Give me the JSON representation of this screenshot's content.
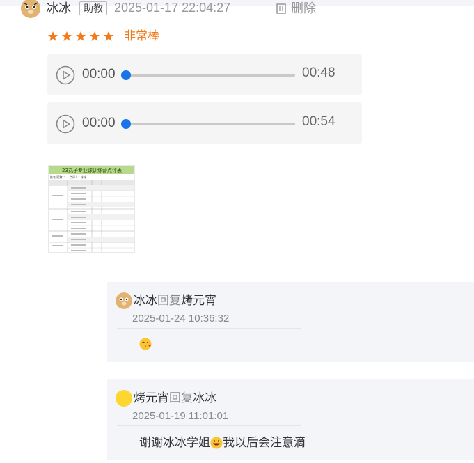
{
  "comment": {
    "author": "冰冰",
    "role_badge": "助教",
    "timestamp": "2025-01-17 22:04:27",
    "delete_label": "删除",
    "rating": {
      "stars": 5,
      "max": 5,
      "label": "非常棒"
    }
  },
  "audio_clips": [
    {
      "current": "00:00",
      "duration": "00:48",
      "progress": 0
    },
    {
      "current": "00:00",
      "duration": "00:54",
      "progress": 0
    }
  ],
  "attachment": {
    "title": "23丸子专业课训练营点评表",
    "subtitle_left": "姓名(昵称)：",
    "subtitle_right": "点评人：冰冰"
  },
  "replies": [
    {
      "from": "冰冰",
      "reply_word": "回复",
      "to": "烤元宵",
      "time": "2025-01-24 10:36:32",
      "body": "",
      "emoji": "kiss-face"
    },
    {
      "from": "烤元宵",
      "reply_word": "回复",
      "to": "冰冰",
      "time": "2025-01-19 11:01:01",
      "body_before": "谢谢冰冰学姐",
      "emoji": "grin-face",
      "body_after": "我以后会注意滴"
    }
  ],
  "colors": {
    "accent_orange": "#f27a1a",
    "player_blue": "#1a73e8",
    "reply_bg": "#f3f5f9"
  }
}
